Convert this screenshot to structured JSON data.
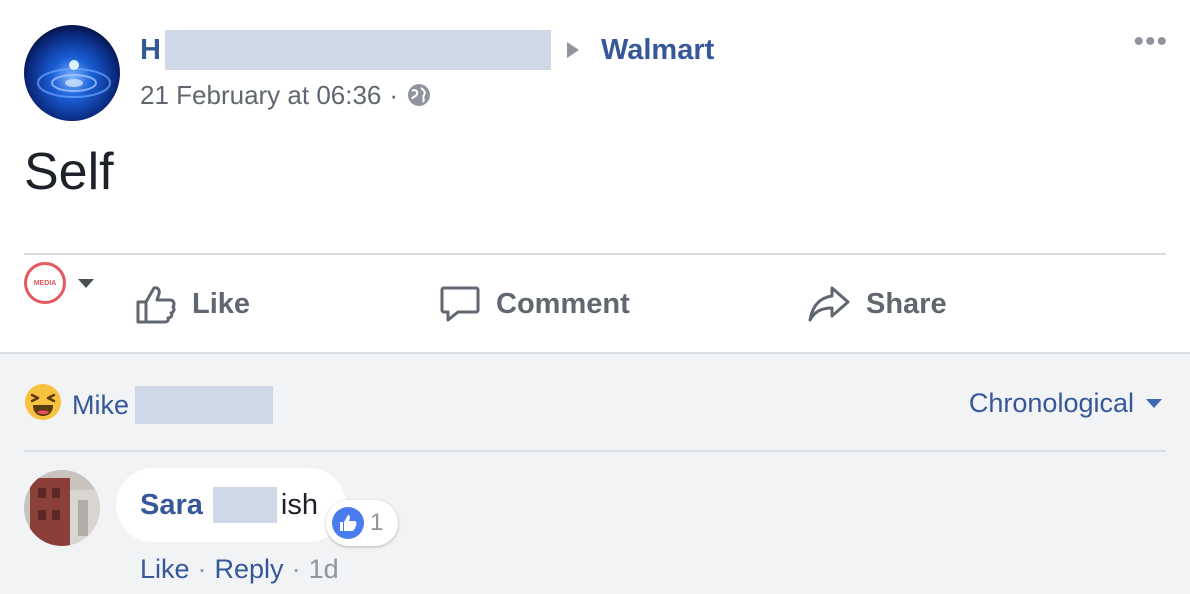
{
  "post": {
    "author_initial": "H",
    "target_page": "Walmart",
    "timestamp": "21 February at 06:36",
    "separator": "·",
    "privacy_icon": "globe-icon",
    "more_icon": "•••",
    "text": "Self"
  },
  "actions": {
    "like_label": "Like",
    "comment_label": "Comment",
    "share_label": "Share",
    "page_badge_text": "MEDIA"
  },
  "comments": {
    "reaction_icon": "haha-emoji-icon",
    "reactor_name": "Mike",
    "sort_label": "Chronological",
    "items": [
      {
        "author": "Sara",
        "text": "ish",
        "like_count": "1",
        "like_label": "Like",
        "reply_label": "Reply",
        "separator": "·",
        "age": "1d"
      }
    ]
  },
  "colors": {
    "link_blue": "#365899",
    "muted_gray": "#616770",
    "comment_bg": "#f2f3f5",
    "redaction": "#cfd8e6",
    "page_badge": "#e6575f"
  }
}
